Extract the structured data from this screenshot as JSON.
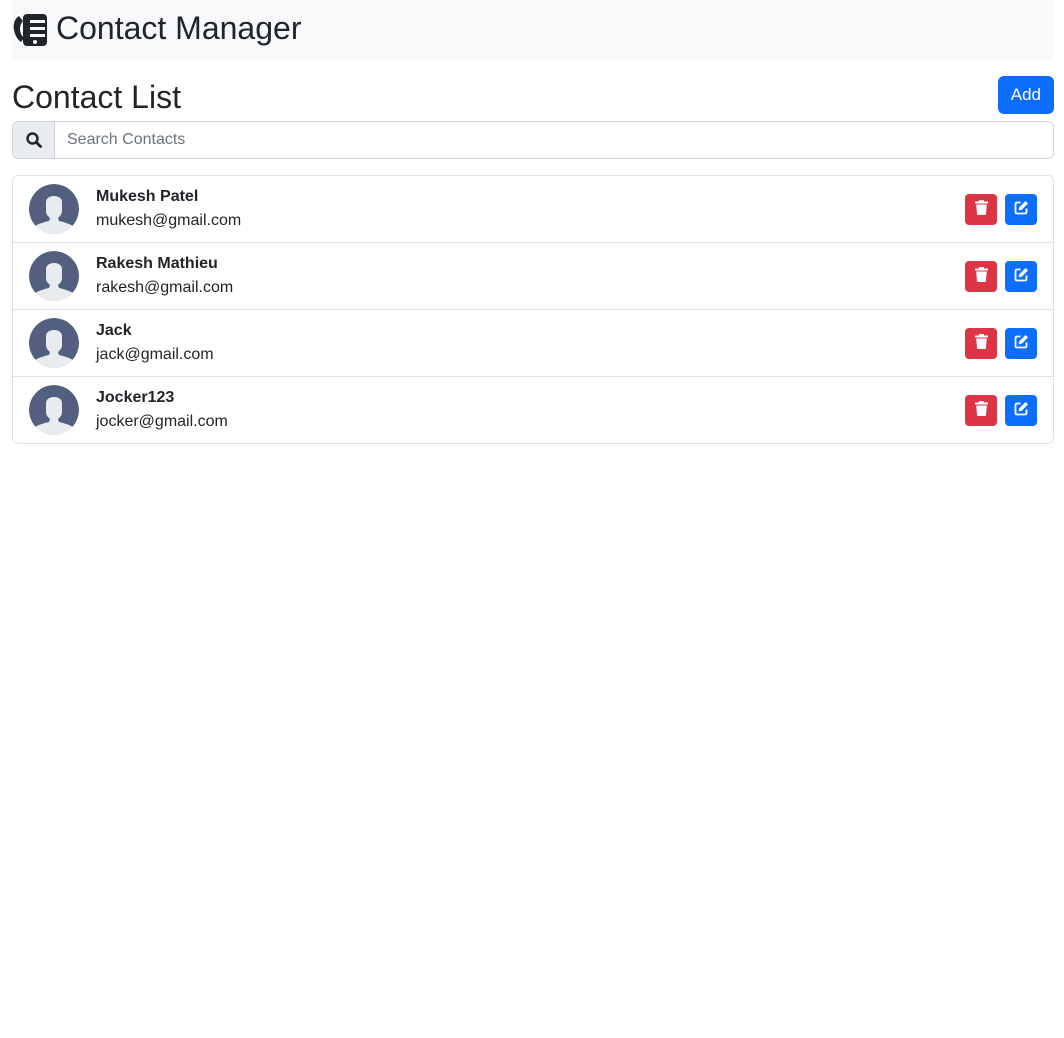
{
  "app": {
    "title": "Contact Manager",
    "brand_icon": "phone-book-icon"
  },
  "page": {
    "title": "Contact List",
    "add_label": "Add"
  },
  "search": {
    "placeholder": "Search Contacts",
    "value": "",
    "icon": "search-icon"
  },
  "contacts": [
    {
      "name": "Mukesh Patel",
      "email": "mukesh@gmail.com"
    },
    {
      "name": "Rakesh Mathieu",
      "email": "rakesh@gmail.com"
    },
    {
      "name": "Jack",
      "email": "jack@gmail.com"
    },
    {
      "name": "Jocker123",
      "email": "jocker@gmail.com"
    }
  ],
  "row_actions": {
    "delete_icon": "trash-icon",
    "edit_icon": "edit-icon"
  },
  "colors": {
    "primary": "#0d6efd",
    "danger": "#dc3545",
    "navbar_bg": "#f8f9fa",
    "avatar_bg": "#535f7e"
  }
}
